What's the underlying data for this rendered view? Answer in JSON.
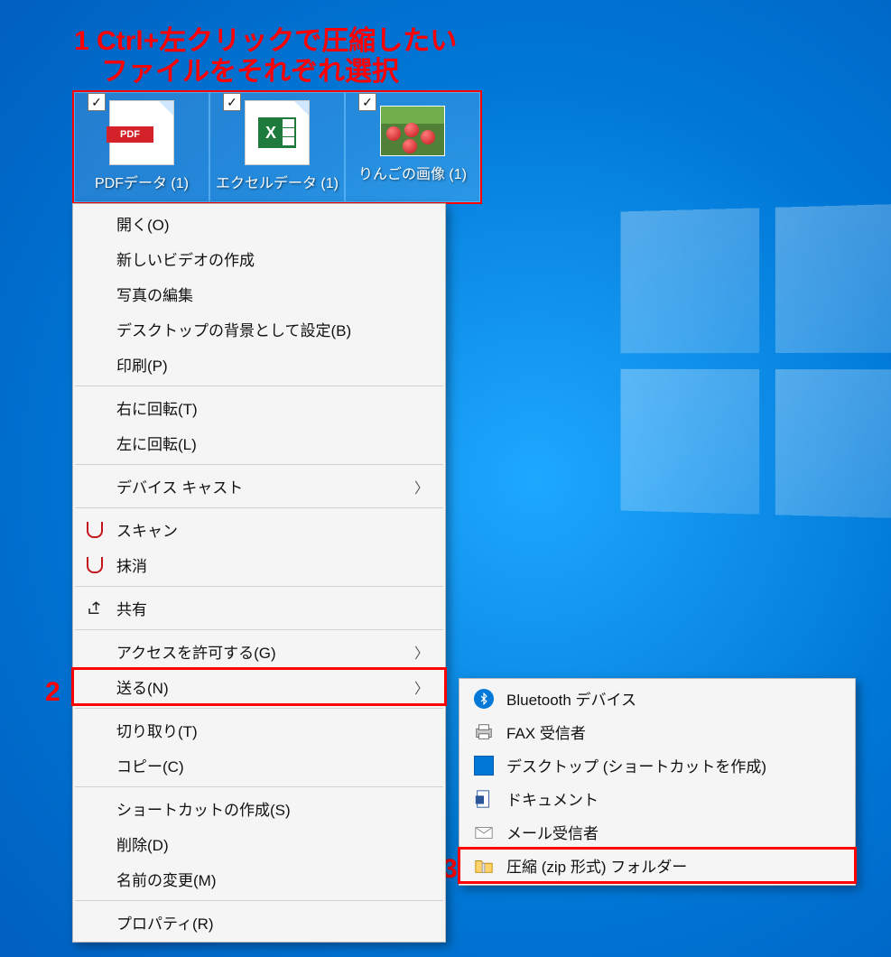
{
  "annotation": {
    "step1_line1": "1 Ctrl+左クリックで圧縮したい",
    "step1_line2": "ファイルをそれぞれ選択",
    "step2_num": "2",
    "step3_num": "3"
  },
  "desktop_icons": [
    {
      "label": "PDFデータ (1)",
      "type": "pdf",
      "checked": true
    },
    {
      "label": "エクセルデータ (1)",
      "type": "xls",
      "checked": true
    },
    {
      "label": "りんごの画像 (1)",
      "type": "image",
      "checked": true
    }
  ],
  "context_menu": {
    "groups": [
      [
        {
          "label": "開く(O)"
        },
        {
          "label": "新しいビデオの作成"
        },
        {
          "label": "写真の編集"
        },
        {
          "label": "デスクトップの背景として設定(B)"
        },
        {
          "label": "印刷(P)"
        }
      ],
      [
        {
          "label": "右に回転(T)"
        },
        {
          "label": "左に回転(L)"
        }
      ],
      [
        {
          "label": "デバイス キャスト",
          "arrow": true
        }
      ],
      [
        {
          "label": "スキャン",
          "icon": "shield"
        },
        {
          "label": "抹消",
          "icon": "shield"
        }
      ],
      [
        {
          "label": "共有",
          "icon": "share"
        }
      ],
      [
        {
          "label": "アクセスを許可する(G)",
          "arrow": true
        },
        {
          "label": "送る(N)",
          "arrow": true,
          "highlight": true
        }
      ],
      [
        {
          "label": "切り取り(T)"
        },
        {
          "label": "コピー(C)"
        }
      ],
      [
        {
          "label": "ショートカットの作成(S)"
        },
        {
          "label": "削除(D)"
        },
        {
          "label": "名前の変更(M)"
        }
      ],
      [
        {
          "label": "プロパティ(R)"
        }
      ]
    ]
  },
  "submenu": {
    "items": [
      {
        "label": "Bluetooth デバイス",
        "icon": "bluetooth"
      },
      {
        "label": "FAX 受信者",
        "icon": "fax"
      },
      {
        "label": "デスクトップ (ショートカットを作成)",
        "icon": "desktop"
      },
      {
        "label": "ドキュメント",
        "icon": "document"
      },
      {
        "label": "メール受信者",
        "icon": "mail"
      },
      {
        "label": "圧縮 (zip 形式) フォルダー",
        "icon": "zip",
        "highlight": true
      }
    ]
  },
  "icon_text": {
    "pdf": "PDF",
    "xls_x": "X"
  }
}
